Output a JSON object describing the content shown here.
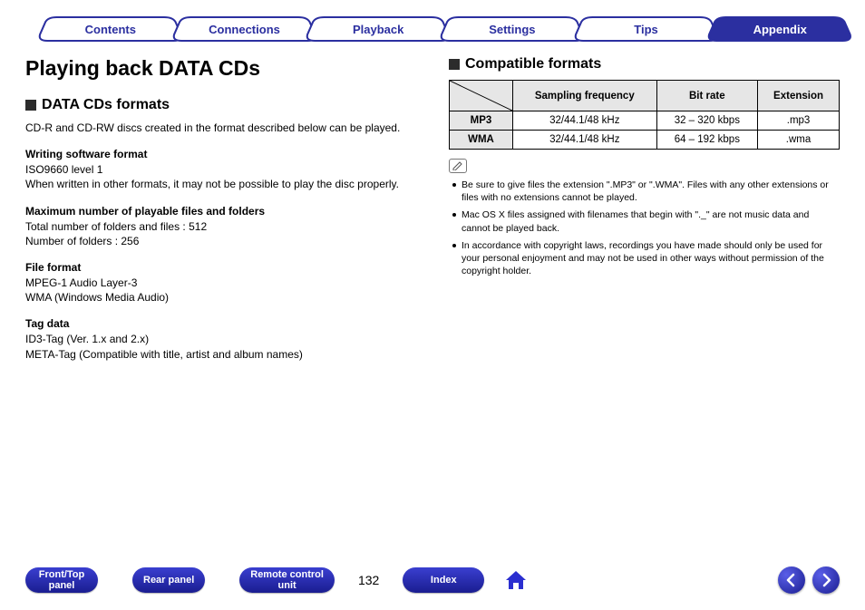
{
  "tabs": [
    {
      "label": "Contents",
      "active": false
    },
    {
      "label": "Connections",
      "active": false
    },
    {
      "label": "Playback",
      "active": false
    },
    {
      "label": "Settings",
      "active": false
    },
    {
      "label": "Tips",
      "active": false
    },
    {
      "label": "Appendix",
      "active": true
    }
  ],
  "title": "Playing back DATA CDs",
  "left": {
    "heading": "DATA CDs formats",
    "intro": "CD-R and CD-RW discs created in the format described below can be played.",
    "s1_h": "Writing software format",
    "s1_l1": "ISO9660 level 1",
    "s1_l2": "When written in other formats, it may not be possible to play the disc properly.",
    "s2_h": "Maximum number of playable files and folders",
    "s2_l1": "Total number of folders and files : 512",
    "s2_l2": "Number of folders : 256",
    "s3_h": "File format",
    "s3_l1": "MPEG-1 Audio Layer-3",
    "s3_l2": "WMA (Windows Media Audio)",
    "s4_h": "Tag data",
    "s4_l1": "ID3-Tag (Ver. 1.x and 2.x)",
    "s4_l2": "META-Tag (Compatible with title, artist and album names)"
  },
  "right": {
    "heading": "Compatible formats",
    "th1": "Sampling frequency",
    "th2": "Bit rate",
    "th3": "Extension",
    "rows": [
      {
        "name": "MP3",
        "sf": "32/44.1/48 kHz",
        "br": "32 – 320 kbps",
        "ext": ".mp3"
      },
      {
        "name": "WMA",
        "sf": "32/44.1/48 kHz",
        "br": "64 – 192 kbps",
        "ext": ".wma"
      }
    ],
    "notes": [
      "Be sure to give files the extension \".MP3\" or \".WMA\". Files with any other extensions or files with no extensions cannot be played.",
      "Mac OS X files assigned with filenames that begin with \"._\" are not music data and cannot be played back.",
      "In accordance with copyright laws, recordings you have made should only be used for your personal enjoyment and may not be used in other ways without permission of the copyright holder."
    ]
  },
  "bottom": {
    "b1a": "Front/Top",
    "b1b": "panel",
    "b2": "Rear panel",
    "b3a": "Remote control",
    "b3b": "unit",
    "page": "132",
    "b4": "Index"
  }
}
